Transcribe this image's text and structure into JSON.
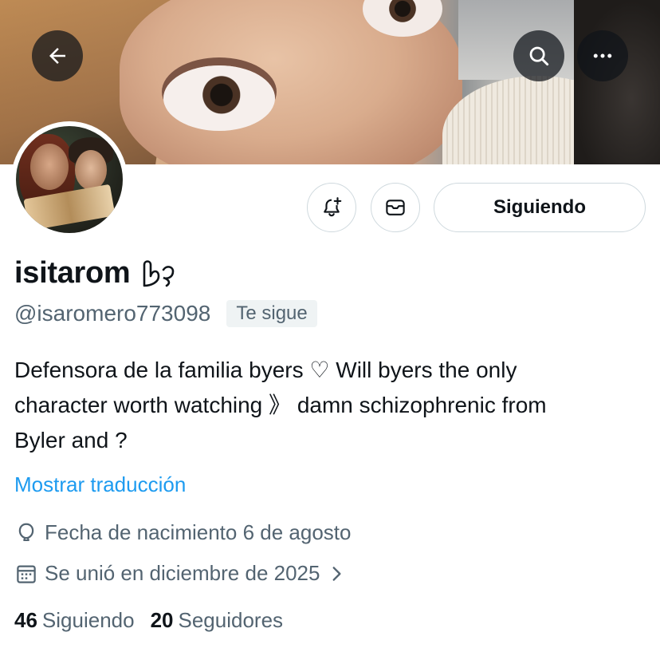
{
  "header": {
    "back_icon": "arrow-left-icon",
    "search_icon": "search-icon",
    "more_icon": "more-horizontal-icon"
  },
  "profile": {
    "display_name": "isitarom",
    "name_glyph": "hand-heart-icon",
    "handle": "@isaromero773098",
    "follows_you_badge": "Te sigue",
    "bio_line1": "Defensora de la familia byers ♡ Will byers the only",
    "bio_line2": "character worth watching 》 damn schizophrenic from",
    "bio_line3": "Byler and ?",
    "translate_link": "Mostrar traducción",
    "birth_date": "Fecha de nacimiento 6 de agosto",
    "joined": "Se unió en diciembre de 2025",
    "following_count": "46",
    "following_label": "Siguiendo",
    "followers_count": "20",
    "followers_label": "Seguidores"
  },
  "actions": {
    "notify_icon": "bell-plus-icon",
    "message_icon": "envelope-icon",
    "follow_state_label": "Siguiendo"
  },
  "colors": {
    "link": "#1d9bf0",
    "secondary_text": "#536471",
    "primary_text": "#0f1419",
    "border": "#cfd9de",
    "badge_bg": "#eff3f4"
  }
}
